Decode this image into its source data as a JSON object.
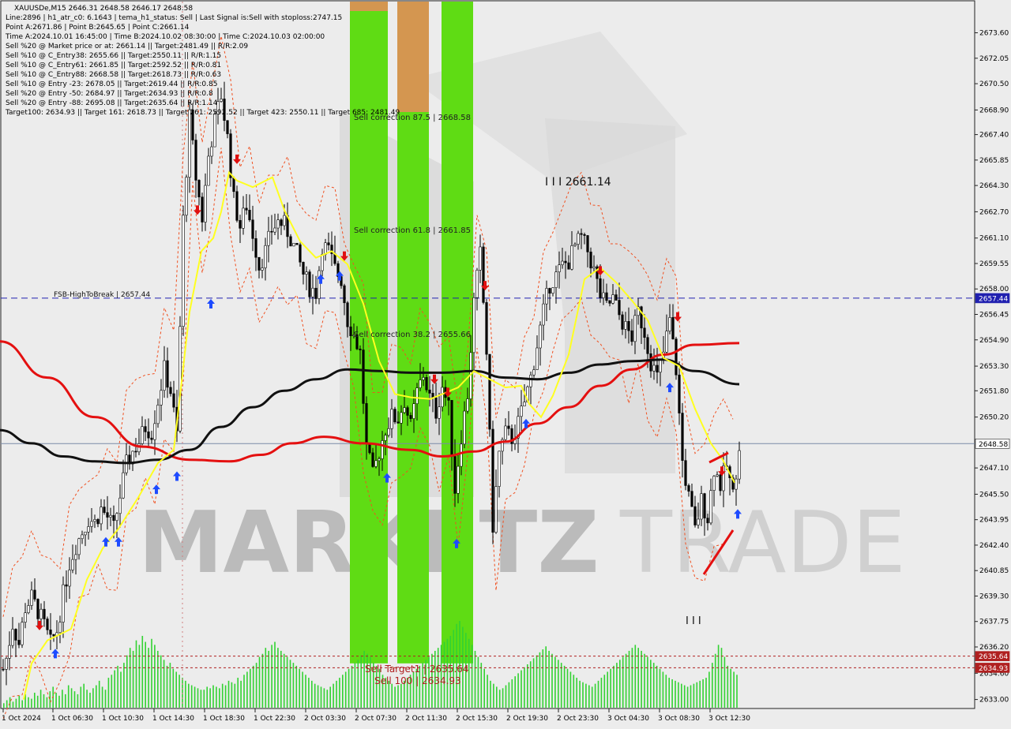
{
  "header": {
    "lines": [
      "XAUUSDe,M15  2646.31 2648.58 2646.17 2648.58",
      "Line:2896 | h1_atr_c0: 6.1643 | tema_h1_status: Sell | Last Signal is:Sell with stoploss:2747.15",
      "Point A:2671.86 | Point B:2645.65 | Point C:2661.14",
      "Time A:2024.10.01 16:45:00 | Time B:2024.10.02 08:30:00 | Time C:2024.10.03 02:00:00",
      "Sell %20 @ Market price or at: 2661.14 || Target:2481.49 || R/R:2.09",
      "Sell %10 @ C_Entry38: 2655.66 || Target:2550.11 || R/R:1.15",
      "Sell %10 @ C_Entry61: 2661.85 || Target:2592.52 || R/R:0.81",
      "Sell %10 @ C_Entry88: 2668.58 || Target:2618.73 || R/R:0.63",
      "Sell %10 @ Entry -23: 2678.05 || Target:2619.44 || R/R:0.85",
      "Sell %20 @ Entry -50: 2684.97 || Target:2634.93 || R/R:0.8",
      "Sell %20 @ Entry -88: 2695.08 || Target:2635.64 || R/R:1.14",
      "Target100: 2634.93 || Target 161: 2618.73 || Target 261: 2592.52 || Target 423: 2550.11 || Target 685: 2481.49"
    ]
  },
  "annotations": {
    "sell_correction_875": "Sell correction 87.5 | 2668.58",
    "sell_correction_618": "Sell correction 61.8 | 2661.85",
    "sell_correction_382": "Sell correction 38.2 | 2655.66",
    "point_c": "I I I 2661.14",
    "fsb": "FSB-HighToBreak | 2657.44",
    "sell_target1": "Sell Target1 | 2635.64",
    "sell_100": "Sell 100 | 2634.93",
    "bars_marker": "I I I"
  },
  "watermark": {
    "left": "MARKETZ",
    "right": "TRADE",
    "color_dark": "#8a8a8a",
    "color_light": "#b4b4b4"
  },
  "colors": {
    "background": "#ececec",
    "bull_candle": "#000000",
    "bear_candle": "#000000",
    "ema_red": "#e41010",
    "ema_black": "#111111",
    "tema_yellow": "#ffff20",
    "envelope": "#f05020",
    "zone_green": "#5fdc14",
    "zone_orange": "#d49650",
    "volume": "#32d232",
    "blue_line": "#2020b0",
    "price_tag": "#2020b0",
    "target_tag": "#b02020",
    "arrow_up": "#1e4bff",
    "arrow_down": "#e01010"
  },
  "chart_data": {
    "type": "candlestick",
    "symbol": "XAUUSDe",
    "timeframe": "M15",
    "ohlc_last": {
      "open": 2646.31,
      "high": 2648.58,
      "low": 2646.17,
      "close": 2648.58
    },
    "ylim": [
      2632.5,
      2675.5
    ],
    "y_ticks": [
      2673.6,
      2672.05,
      2670.5,
      2668.9,
      2667.4,
      2665.85,
      2664.3,
      2662.7,
      2661.1,
      2659.55,
      2658.0,
      2656.45,
      2654.9,
      2653.3,
      2651.8,
      2650.2,
      2647.1,
      2645.5,
      2643.95,
      2642.4,
      2640.85,
      2639.3,
      2637.75,
      2636.2,
      2634.6,
      2633.0
    ],
    "y_tick_labels": [
      "2673.60",
      "2672.05",
      "2670.50",
      "2668.90",
      "2667.40",
      "2665.85",
      "2664.30",
      "2662.70",
      "2661.10",
      "2659.55",
      "2658.00",
      "2656.45",
      "2654.90",
      "2653.30",
      "2651.80",
      "2650.20",
      "2647.10",
      "2645.50",
      "2643.95",
      "2642.40",
      "2640.85",
      "2639.30",
      "2637.75",
      "2636.20",
      "2634.60",
      "2633.00"
    ],
    "x_tick_labels": [
      "1 Oct 2024",
      "1 Oct 06:30",
      "1 Oct 10:30",
      "1 Oct 14:30",
      "1 Oct 18:30",
      "1 Oct 22:30",
      "2 Oct 03:30",
      "2 Oct 07:30",
      "2 Oct 11:30",
      "2 Oct 15:30",
      "2 Oct 19:30",
      "2 Oct 23:30",
      "3 Oct 04:30",
      "3 Oct 08:30",
      "3 Oct 12:30"
    ],
    "price_tags": [
      {
        "label": "2657.44",
        "value": 2657.44,
        "kind": "blue"
      },
      {
        "label": "2648.58",
        "value": 2648.58,
        "kind": "current"
      },
      {
        "label": "2635.64",
        "value": 2635.64,
        "kind": "target"
      },
      {
        "label": "2634.93",
        "value": 2634.93,
        "kind": "target"
      }
    ],
    "levels": {
      "fsb": 2657.44,
      "current": 2648.58,
      "target1": 2635.64,
      "sell100": 2634.93
    },
    "close_path": [
      [
        0,
        2634.2
      ],
      [
        8,
        2635.5
      ],
      [
        16,
        2637.6
      ],
      [
        24,
        2636.4
      ],
      [
        32,
        2638.6
      ],
      [
        40,
        2639.2
      ],
      [
        48,
        2638.4
      ],
      [
        56,
        2637.5
      ],
      [
        64,
        2636.4
      ],
      [
        72,
        2637.2
      ],
      [
        80,
        2639.4
      ],
      [
        88,
        2641.3
      ],
      [
        96,
        2642.4
      ],
      [
        104,
        2643.2
      ],
      [
        112,
        2644.0
      ],
      [
        120,
        2643.8
      ],
      [
        128,
        2644.6
      ],
      [
        136,
        2644.1
      ],
      [
        144,
        2643.4
      ],
      [
        152,
        2645.4
      ],
      [
        160,
        2647.3
      ],
      [
        168,
        2648.1
      ],
      [
        176,
        2648.7
      ],
      [
        184,
        2649.6
      ],
      [
        192,
        2649.3
      ],
      [
        200,
        2651.2
      ],
      [
        208,
        2653.1
      ],
      [
        216,
        2651.8
      ],
      [
        224,
        2649.1
      ],
      [
        232,
        2662.2
      ],
      [
        240,
        2668.4
      ],
      [
        248,
        2664.8
      ],
      [
        256,
        2662.3
      ],
      [
        264,
        2666.1
      ],
      [
        272,
        2668.2
      ],
      [
        280,
        2669.8
      ],
      [
        288,
        2667.2
      ],
      [
        296,
        2663.4
      ],
      [
        304,
        2661.8
      ],
      [
        312,
        2663.1
      ],
      [
        320,
        2661.4
      ],
      [
        328,
        2659.4
      ],
      [
        336,
        2660.3
      ],
      [
        344,
        2661.6
      ],
      [
        352,
        2662.1
      ],
      [
        360,
        2661.9
      ],
      [
        368,
        2661.1
      ],
      [
        376,
        2660.1
      ],
      [
        384,
        2658.9
      ],
      [
        392,
        2658.1
      ],
      [
        400,
        2657.8
      ],
      [
        408,
        2660.7
      ],
      [
        416,
        2660.3
      ],
      [
        424,
        2659.2
      ],
      [
        432,
        2658.6
      ],
      [
        440,
        2656.1
      ],
      [
        448,
        2655.2
      ],
      [
        456,
        2654.1
      ],
      [
        464,
        2648.3
      ],
      [
        472,
        2646.6
      ],
      [
        480,
        2648.1
      ],
      [
        488,
        2649.5
      ],
      [
        496,
        2650.2
      ],
      [
        504,
        2650.1
      ],
      [
        512,
        2651.2
      ],
      [
        520,
        2649.6
      ],
      [
        528,
        2651.7
      ],
      [
        536,
        2652.8
      ],
      [
        544,
        2651.4
      ],
      [
        552,
        2650.5
      ],
      [
        560,
        2652.1
      ],
      [
        568,
        2650.7
      ],
      [
        576,
        2645.8
      ],
      [
        584,
        2649.1
      ],
      [
        592,
        2651.6
      ],
      [
        600,
        2657.2
      ],
      [
        608,
        2660.1
      ],
      [
        616,
        2654.2
      ],
      [
        624,
        2643.6
      ],
      [
        632,
        2648.0
      ],
      [
        640,
        2649.2
      ],
      [
        648,
        2648.9
      ],
      [
        656,
        2649.8
      ],
      [
        664,
        2651.1
      ],
      [
        672,
        2652.6
      ],
      [
        680,
        2654.6
      ],
      [
        688,
        2656.6
      ],
      [
        696,
        2658.3
      ],
      [
        704,
        2658.8
      ],
      [
        712,
        2659.4
      ],
      [
        720,
        2659.7
      ],
      [
        728,
        2660.6
      ],
      [
        736,
        2661.1
      ],
      [
        744,
        2660.3
      ],
      [
        752,
        2659.1
      ],
      [
        760,
        2657.6
      ],
      [
        768,
        2656.9
      ],
      [
        776,
        2657.4
      ],
      [
        784,
        2656.4
      ],
      [
        792,
        2655.6
      ],
      [
        800,
        2655.1
      ],
      [
        808,
        2656.6
      ],
      [
        816,
        2655.4
      ],
      [
        824,
        2653.6
      ],
      [
        832,
        2652.6
      ],
      [
        840,
        2654.1
      ],
      [
        848,
        2656.1
      ],
      [
        856,
        2653.1
      ],
      [
        864,
        2647.5
      ],
      [
        872,
        2645.3
      ],
      [
        880,
        2643.3
      ],
      [
        888,
        2645.1
      ],
      [
        896,
        2644.1
      ],
      [
        904,
        2647.1
      ],
      [
        912,
        2646.1
      ],
      [
        920,
        2647.2
      ],
      [
        928,
        2645.4
      ],
      [
        936,
        2648.58
      ]
    ],
    "ema_red_path": [
      [
        0,
        2654.8
      ],
      [
        60,
        2652.6
      ],
      [
        120,
        2650.2
      ],
      [
        180,
        2648.4
      ],
      [
        240,
        2647.6
      ],
      [
        290,
        2647.5
      ],
      [
        330,
        2647.9
      ],
      [
        370,
        2648.6
      ],
      [
        410,
        2649.0
      ],
      [
        460,
        2648.6
      ],
      [
        520,
        2648.2
      ],
      [
        560,
        2647.8
      ],
      [
        600,
        2648.1
      ],
      [
        640,
        2648.7
      ],
      [
        680,
        2649.8
      ],
      [
        720,
        2650.8
      ],
      [
        760,
        2652.1
      ],
      [
        800,
        2653.1
      ],
      [
        840,
        2654.0
      ],
      [
        880,
        2654.6
      ],
      [
        936,
        2654.7
      ]
    ],
    "ema_black_path": [
      [
        0,
        2649.4
      ],
      [
        40,
        2648.6
      ],
      [
        80,
        2647.8
      ],
      [
        120,
        2647.5
      ],
      [
        160,
        2647.4
      ],
      [
        200,
        2647.6
      ],
      [
        240,
        2648.2
      ],
      [
        280,
        2649.6
      ],
      [
        320,
        2650.8
      ],
      [
        360,
        2651.8
      ],
      [
        400,
        2652.5
      ],
      [
        440,
        2653.1
      ],
      [
        480,
        2653.0
      ],
      [
        520,
        2652.9
      ],
      [
        560,
        2652.9
      ],
      [
        600,
        2653.0
      ],
      [
        640,
        2652.6
      ],
      [
        680,
        2652.5
      ],
      [
        720,
        2652.9
      ],
      [
        760,
        2653.4
      ],
      [
        800,
        2653.6
      ],
      [
        840,
        2653.7
      ],
      [
        880,
        2653.0
      ],
      [
        936,
        2652.2
      ]
    ],
    "tema_yellow_path": [
      [
        30,
        2633.0
      ],
      [
        40,
        2635.2
      ],
      [
        60,
        2636.6
      ],
      [
        90,
        2637.3
      ],
      [
        110,
        2640.3
      ],
      [
        130,
        2642.2
      ],
      [
        150,
        2643.4
      ],
      [
        175,
        2645.3
      ],
      [
        200,
        2647.4
      ],
      [
        220,
        2648.2
      ],
      [
        240,
        2656.6
      ],
      [
        255,
        2660.3
      ],
      [
        270,
        2661.1
      ],
      [
        280,
        2662.7
      ],
      [
        290,
        2665.1
      ],
      [
        300,
        2664.6
      ],
      [
        320,
        2664.2
      ],
      [
        345,
        2664.8
      ],
      [
        360,
        2662.8
      ],
      [
        380,
        2660.9
      ],
      [
        400,
        2659.9
      ],
      [
        420,
        2660.3
      ],
      [
        440,
        2659.5
      ],
      [
        460,
        2657.1
      ],
      [
        480,
        2653.6
      ],
      [
        500,
        2651.6
      ],
      [
        520,
        2651.4
      ],
      [
        545,
        2651.3
      ],
      [
        560,
        2651.6
      ],
      [
        580,
        2652.0
      ],
      [
        600,
        2653.0
      ],
      [
        620,
        2652.5
      ],
      [
        640,
        2652.0
      ],
      [
        660,
        2652.1
      ],
      [
        670,
        2651.0
      ],
      [
        685,
        2650.2
      ],
      [
        700,
        2651.5
      ],
      [
        720,
        2654.0
      ],
      [
        740,
        2658.6
      ],
      [
        760,
        2659.3
      ],
      [
        780,
        2658.4
      ],
      [
        800,
        2657.3
      ],
      [
        820,
        2656.1
      ],
      [
        840,
        2653.8
      ],
      [
        860,
        2653.3
      ],
      [
        880,
        2650.7
      ],
      [
        900,
        2648.6
      ],
      [
        915,
        2647.6
      ],
      [
        930,
        2646.2
      ]
    ],
    "arrows_up": [
      [
        70,
        2635.8
      ],
      [
        134,
        2642.6
      ],
      [
        150,
        2642.6
      ],
      [
        198,
        2645.8
      ],
      [
        224,
        2646.6
      ],
      [
        267,
        2657.1
      ],
      [
        406,
        2658.6
      ],
      [
        430,
        2658.8
      ],
      [
        490,
        2646.5
      ],
      [
        578,
        2642.5
      ],
      [
        666,
        2649.8
      ],
      [
        848,
        2652.0
      ],
      [
        934,
        2644.3
      ]
    ],
    "arrows_down": [
      [
        50,
        2637.5
      ],
      [
        250,
        2662.8
      ],
      [
        300,
        2665.9
      ],
      [
        436,
        2660.0
      ],
      [
        550,
        2652.5
      ],
      [
        567,
        2651.7
      ],
      [
        614,
        2658.2
      ],
      [
        760,
        2659.1
      ],
      [
        858,
        2656.3
      ],
      [
        914,
        2646.9
      ]
    ],
    "zones": [
      {
        "x0": 443,
        "x1": 491,
        "y0": 2675.5,
        "y1": 2635.2,
        "color": "green",
        "cap": "orange"
      },
      {
        "x0": 503,
        "x1": 543,
        "y0": 2675.5,
        "y1": 2635.2,
        "color": "green",
        "cap": "orange_tall"
      },
      {
        "x0": 559,
        "x1": 599,
        "y0": 2675.5,
        "y1": 2635.2,
        "color": "green",
        "cap": "none"
      }
    ],
    "volume": [
      3,
      5,
      7,
      4,
      6,
      8,
      5,
      9,
      7,
      6,
      10,
      8,
      12,
      9,
      7,
      11,
      14,
      10,
      8,
      12,
      9,
      15,
      13,
      11,
      9,
      14,
      16,
      12,
      10,
      13,
      15,
      18,
      14,
      12,
      20,
      22,
      25,
      28,
      24,
      30,
      35,
      40,
      38,
      45,
      42,
      48,
      44,
      40,
      46,
      42,
      38,
      35,
      32,
      28,
      30,
      26,
      24,
      22,
      20,
      18,
      16,
      15,
      14,
      13,
      12,
      12,
      14,
      13,
      15,
      14,
      13,
      16,
      15,
      18,
      17,
      16,
      20,
      18,
      22,
      24,
      26,
      28,
      30,
      34,
      36,
      40,
      38,
      42,
      44,
      40,
      38,
      36,
      34,
      32,
      30,
      28,
      26,
      24,
      22,
      20,
      18,
      16,
      15,
      14,
      13,
      12,
      14,
      16,
      18,
      20,
      22,
      24,
      26,
      28,
      30,
      32,
      35,
      38,
      36,
      34,
      30,
      28,
      26,
      22,
      20,
      18,
      16,
      14,
      15,
      16,
      18,
      20,
      22,
      24,
      26,
      28,
      30,
      32,
      34,
      36,
      38,
      40,
      42,
      44,
      46,
      48,
      52,
      56,
      58,
      54,
      50,
      46,
      42,
      38,
      34,
      30,
      26,
      22,
      18,
      16,
      14,
      12,
      13,
      15,
      17,
      19,
      21,
      23,
      25,
      27,
      29,
      31,
      33,
      35,
      37,
      39,
      41,
      38,
      36,
      34,
      32,
      30,
      28,
      26,
      24,
      22,
      20,
      18,
      17,
      16,
      15,
      14,
      16,
      18,
      20,
      22,
      24,
      26,
      28,
      30,
      32,
      34,
      36,
      38,
      40,
      42,
      40,
      38,
      36,
      34,
      32,
      30,
      28,
      26,
      24,
      22,
      20,
      19,
      18,
      17,
      16,
      15,
      14,
      15,
      16,
      17,
      18,
      19,
      20,
      24,
      30,
      36,
      42,
      40,
      34,
      28,
      26,
      24,
      22,
      20,
      22,
      24,
      26,
      28,
      30,
      28,
      26,
      24
    ]
  }
}
